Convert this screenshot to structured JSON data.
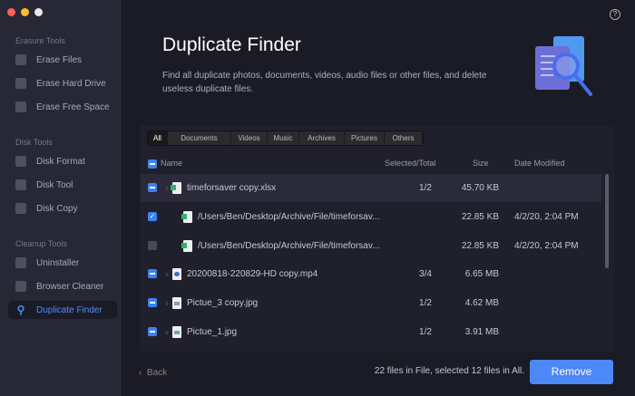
{
  "window": {
    "traffic_colors": [
      "#fe5f57",
      "#febc2e",
      "#e8e8e8"
    ]
  },
  "sidebar": {
    "sections": [
      {
        "label": "Erasure Tools",
        "items": [
          {
            "label": "Erase Files",
            "icon": "shredder-icon"
          },
          {
            "label": "Erase Hard Drive",
            "icon": "hard-drive-icon"
          },
          {
            "label": "Erase Free Space",
            "icon": "disk-icon"
          }
        ]
      },
      {
        "label": "Disk Tools",
        "items": [
          {
            "label": "Disk Format",
            "icon": "paint-roller-icon"
          },
          {
            "label": "Disk Tool",
            "icon": "wrench-icon"
          },
          {
            "label": "Disk Copy",
            "icon": "copy-icon"
          }
        ]
      },
      {
        "label": "Cleanup Tools",
        "items": [
          {
            "label": "Uninstaller",
            "icon": "uninstall-icon"
          },
          {
            "label": "Browser Cleaner",
            "icon": "rocket-icon"
          },
          {
            "label": "Duplicate Finder",
            "icon": "search-icon",
            "active": true
          }
        ]
      }
    ]
  },
  "header": {
    "title": "Duplicate Finder",
    "description": "Find all duplicate photos, documents, videos, audio files or other files, and delete useless duplicate files.",
    "help": "?"
  },
  "tabs": [
    "All",
    "Documents",
    "Videos",
    "Music",
    "Archives",
    "Pictures",
    "Others"
  ],
  "columns": {
    "name": "Name",
    "selected": "Selected/Total",
    "size": "Size",
    "date": "Date Modified"
  },
  "rows": [
    {
      "name": "timeforsaver copy.xlsx",
      "selected": "1/2",
      "size": "45.70 KB",
      "date": "",
      "check": "partial",
      "type": "xlsx",
      "child": false
    },
    {
      "name": "/Users/Ben/Desktop/Archive/File/timeforsav...",
      "selected": "",
      "size": "22.85 KB",
      "date": "4/2/20, 2:04 PM",
      "check": "checked",
      "type": "xlsx",
      "child": true
    },
    {
      "name": "/Users/Ben/Desktop/Archive/File/timeforsav...",
      "selected": "",
      "size": "22.85 KB",
      "date": "4/2/20, 2:04 PM",
      "check": "unchecked",
      "type": "xlsx",
      "child": true
    },
    {
      "name": "20200818-220829-HD copy.mp4",
      "selected": "3/4",
      "size": "6.65 MB",
      "date": "",
      "check": "partial",
      "type": "mp4",
      "child": false
    },
    {
      "name": "Pictue_3 copy.jpg",
      "selected": "1/2",
      "size": "4.62 MB",
      "date": "",
      "check": "partial",
      "type": "jpg",
      "child": false
    },
    {
      "name": "Pictue_1.jpg",
      "selected": "1/2",
      "size": "3.91 MB",
      "date": "",
      "check": "partial",
      "type": "jpg",
      "child": false
    }
  ],
  "footer": {
    "back": "Back",
    "status": "22 files in File, selected 12 files in All.",
    "remove": "Remove"
  }
}
